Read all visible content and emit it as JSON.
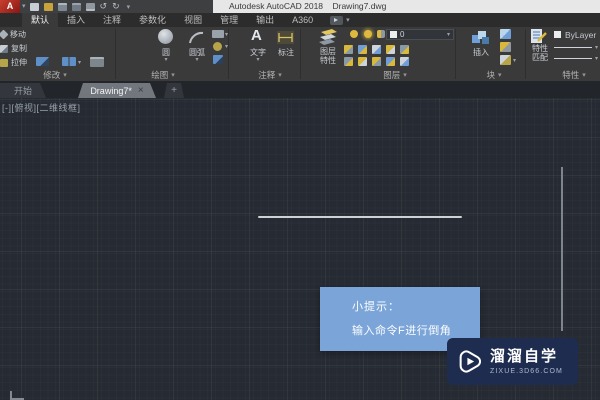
{
  "icons": {
    "chevron_down": "▾",
    "close": "×",
    "plus": "+",
    "undo": "↺",
    "redo": "↻"
  },
  "title_bar": {
    "logo": "A",
    "title": "Autodesk AutoCAD 2018    Drawing7.dwg"
  },
  "ribbon_tabs": [
    "默认",
    "插入",
    "注释",
    "参数化",
    "视图",
    "管理",
    "输出",
    "A360"
  ],
  "panels": {
    "modify": {
      "label": "修改",
      "items": [
        "移动",
        "复制",
        "拉伸"
      ]
    },
    "draw": {
      "label": "绘图",
      "circle_label": "圆",
      "arc_label": "圆弧"
    },
    "annotate": {
      "label": "注释",
      "letter": "A",
      "text_label": "文字",
      "dim_label": "标注"
    },
    "layers": {
      "label": "图层",
      "button_line1": "图层",
      "button_line2": "特性",
      "current_layer": "0"
    },
    "block": {
      "label": "块",
      "insert_label": "插入"
    },
    "properties": {
      "label": "特性",
      "match_line1": "特性",
      "match_line2": "匹配",
      "color_value": "ByLayer"
    }
  },
  "file_tabs": {
    "start_label": "开始",
    "active_label": "Drawing7*"
  },
  "canvas": {
    "viewport_label": "[-][俯视][二维线框]"
  },
  "tooltip": {
    "title": "小提示：",
    "body": "输入命令F进行倒角"
  },
  "watermark": {
    "brand": "溜溜自学",
    "site": "ZIXUE.3D66.COM"
  },
  "colors": {
    "tooltip_bg": "#7ba5d8",
    "watermark_bg": "#1e2c4f",
    "canvas_bg": "#262a32",
    "title_light": "#e7e7e7",
    "autocad_red": "#a62a1e"
  }
}
